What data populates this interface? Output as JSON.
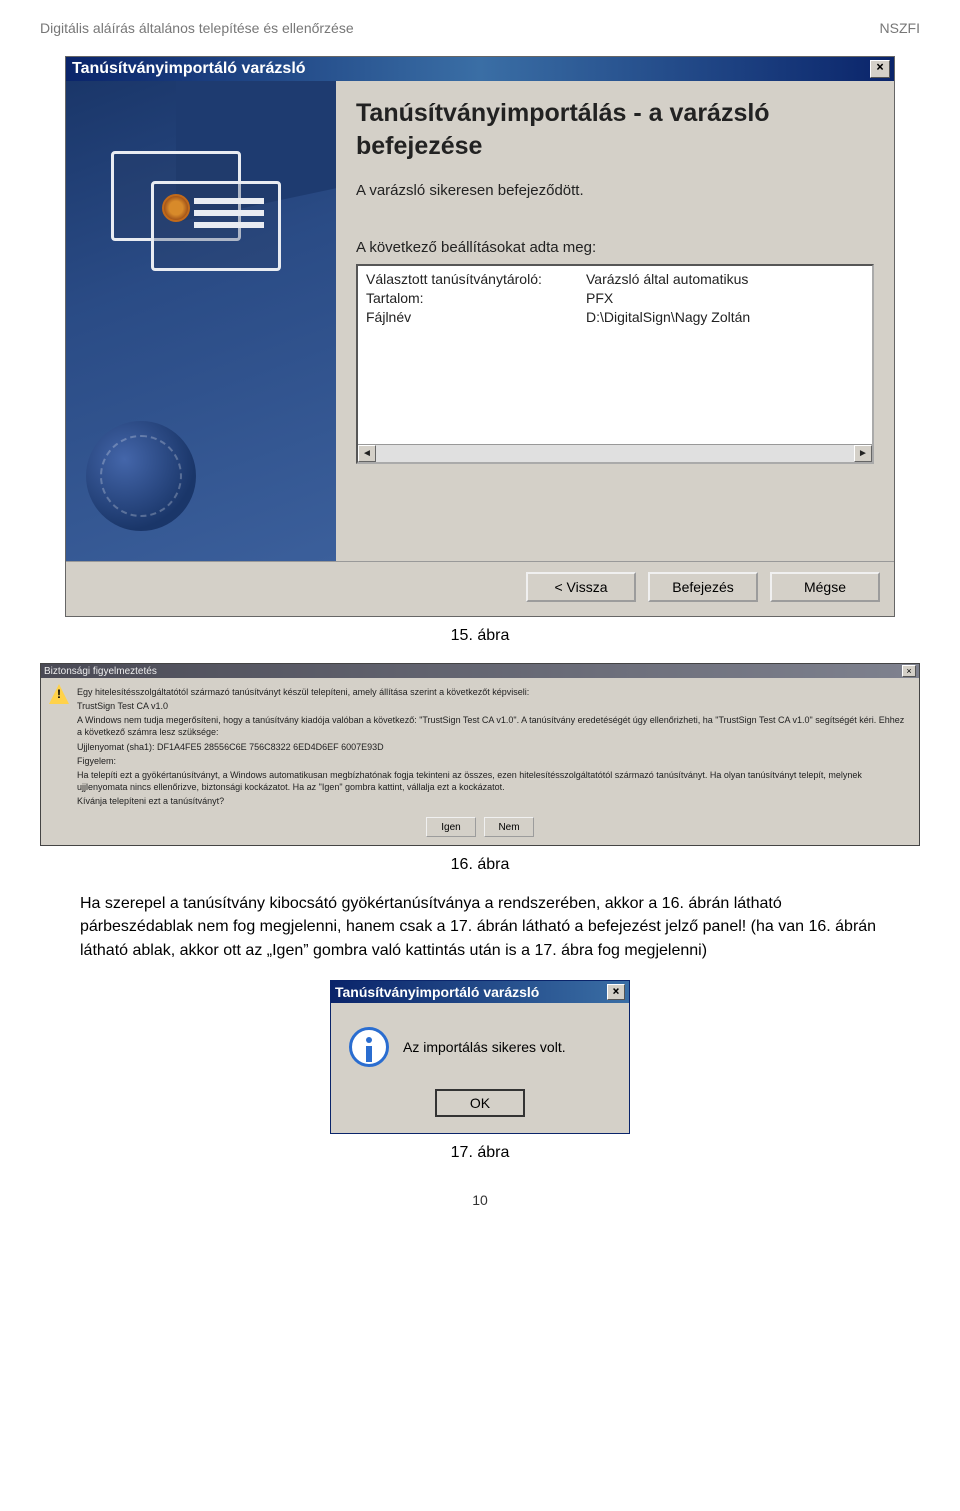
{
  "doc": {
    "header_left": "Digitális aláírás általános telepítése és ellenőrzése",
    "header_right": "NSZFI",
    "page_number": "10"
  },
  "wizard": {
    "title": "Tanúsítványimportáló varázsló",
    "heading": "Tanúsítványimportálás - a varázsló befejezése",
    "line1": "A varázsló sikeresen befejeződött.",
    "line2": "A következő beállításokat adta meg:",
    "rows": [
      {
        "k": "Választott tanúsítványtároló:",
        "v": "Varázsló által automatikus"
      },
      {
        "k": "Tartalom:",
        "v": "PFX"
      },
      {
        "k": "Fájlnév",
        "v": "D:\\DigitalSign\\Nagy Zoltán"
      }
    ],
    "buttons": {
      "back": "< Vissza",
      "finish": "Befejezés",
      "cancel": "Mégse"
    }
  },
  "captions": {
    "fig15": "15. ábra",
    "fig16": "16. ábra",
    "fig17": "17. ábra"
  },
  "security": {
    "title": "Biztonsági figyelmeztetés",
    "p1": "Egy hitelesítésszolgáltatótól származó tanúsítványt készül telepíteni, amely állítása szerint a következőt képviseli:",
    "p2": "TrustSign Test CA v1.0",
    "p3": "A Windows nem tudja megerősíteni, hogy a tanúsítvány kiadója valóban a következő: \"TrustSign Test CA v1.0\". A tanúsítvány eredetéségét úgy ellenőrizheti, ha \"TrustSign Test CA v1.0\" segítségét kéri. Ehhez a következő számra lesz szüksége:",
    "p4": "Ujjlenyomat (sha1): DF1A4FE5 28556C6E 756C8322 6ED4D6EF 6007E93D",
    "p5": "Figyelem:",
    "p6": "Ha telepíti ezt a gyökértanúsítványt, a Windows automatikusan megbízhatónak fogja tekinteni az összes, ezen hitelesítésszolgáltatótól származó tanúsítványt. Ha olyan tanúsítványt telepít, melynek ujjlenyomata nincs ellenőrizve, biztonsági kockázatot. Ha az \"Igen\" gombra kattint, vállalja ezt a kockázatot.",
    "p7": "Kívánja telepíteni ezt a tanúsítványt?",
    "yes": "Igen",
    "no": "Nem"
  },
  "paragraph": "Ha szerepel a tanúsítvány kibocsátó gyökértanúsítványa a rendszerében, akkor a 16. ábrán látható párbeszédablak nem fog megjelenni, hanem csak a 17. ábrán látható a befejezést jelző panel! (ha van 16. ábrán látható ablak, akkor ott az „Igen” gombra való kattintás után is a 17. ábra fog megjelenni)",
  "msgbox": {
    "title": "Tanúsítványimportáló varázsló",
    "text": "Az importálás sikeres volt.",
    "ok": "OK"
  }
}
